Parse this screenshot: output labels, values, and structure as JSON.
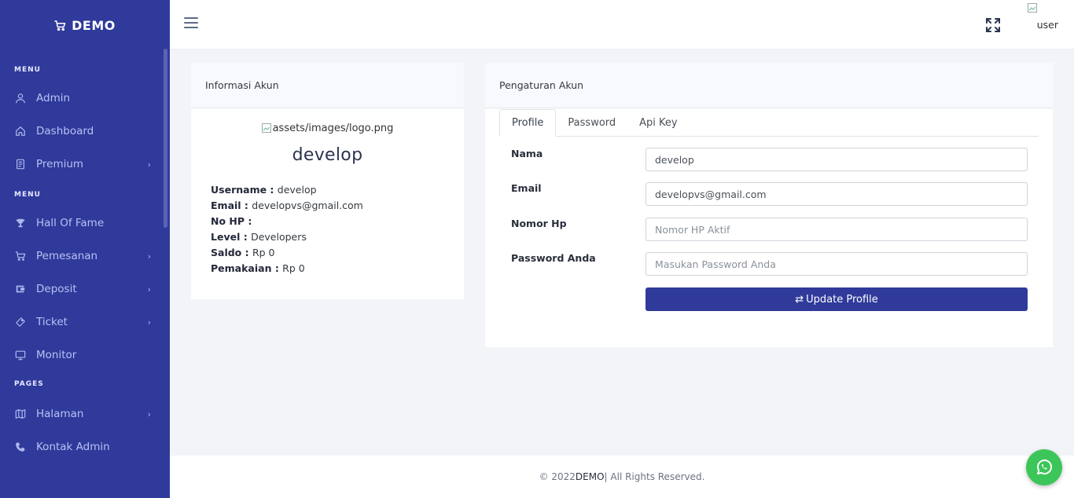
{
  "brand": {
    "name": "DEMO",
    "icon": "cart-icon"
  },
  "sidebar": {
    "sections": [
      {
        "title": "MENU",
        "items": [
          {
            "label": "Admin",
            "icon": "user-icon",
            "has_submenu": false
          },
          {
            "label": "Dashboard",
            "icon": "home-icon",
            "has_submenu": false
          },
          {
            "label": "Premium",
            "icon": "document-icon",
            "has_submenu": true
          }
        ]
      },
      {
        "title": "MENU",
        "items": [
          {
            "label": "Hall Of Fame",
            "icon": "trophy-icon",
            "has_submenu": false
          },
          {
            "label": "Pemesanan",
            "icon": "cart-icon",
            "has_submenu": true
          },
          {
            "label": "Deposit",
            "icon": "wallet-icon",
            "has_submenu": true
          },
          {
            "label": "Ticket",
            "icon": "ticket-icon",
            "has_submenu": true
          },
          {
            "label": "Monitor",
            "icon": "monitor-icon",
            "has_submenu": false
          }
        ]
      },
      {
        "title": "PAGES",
        "items": [
          {
            "label": "Halaman",
            "icon": "map-icon",
            "has_submenu": true
          },
          {
            "label": "Kontak Admin",
            "icon": "phone-icon",
            "has_submenu": false
          }
        ]
      }
    ]
  },
  "topbar": {
    "user_alt": "user"
  },
  "account_info": {
    "title": "Informasi Akun",
    "logo_alt": "assets/images/logo.png",
    "display_name": "develop",
    "fields": [
      {
        "key": "Username",
        "value": "develop"
      },
      {
        "key": "Email",
        "value": "developvs@gmail.com"
      },
      {
        "key": "No HP",
        "value": ""
      },
      {
        "key": "Level",
        "value": "Developers"
      },
      {
        "key": "Saldo",
        "value": "Rp 0"
      },
      {
        "key": "Pemakaian",
        "value": "Rp 0"
      }
    ]
  },
  "settings": {
    "title": "Pengaturan Akun",
    "tabs": [
      {
        "label": "Profile",
        "active": true
      },
      {
        "label": "Password",
        "active": false
      },
      {
        "label": "Api Key",
        "active": false
      }
    ],
    "form": {
      "name_label": "Nama",
      "name_value": "develop",
      "email_label": "Email",
      "email_value": "developvs@gmail.com",
      "phone_label": "Nomor Hp",
      "phone_placeholder": "Nomor HP Aktif",
      "password_label": "Password Anda",
      "password_placeholder": "Masukan Password Anda",
      "submit_label": "Update Profile"
    }
  },
  "footer": {
    "prefix": "© 2022 ",
    "brand": "DEMO",
    "suffix": " | All Rights Reserved."
  },
  "colors": {
    "sidebar": "#2f3a9a",
    "accent": "#2f3a9a",
    "whatsapp": "#3cc65a"
  }
}
